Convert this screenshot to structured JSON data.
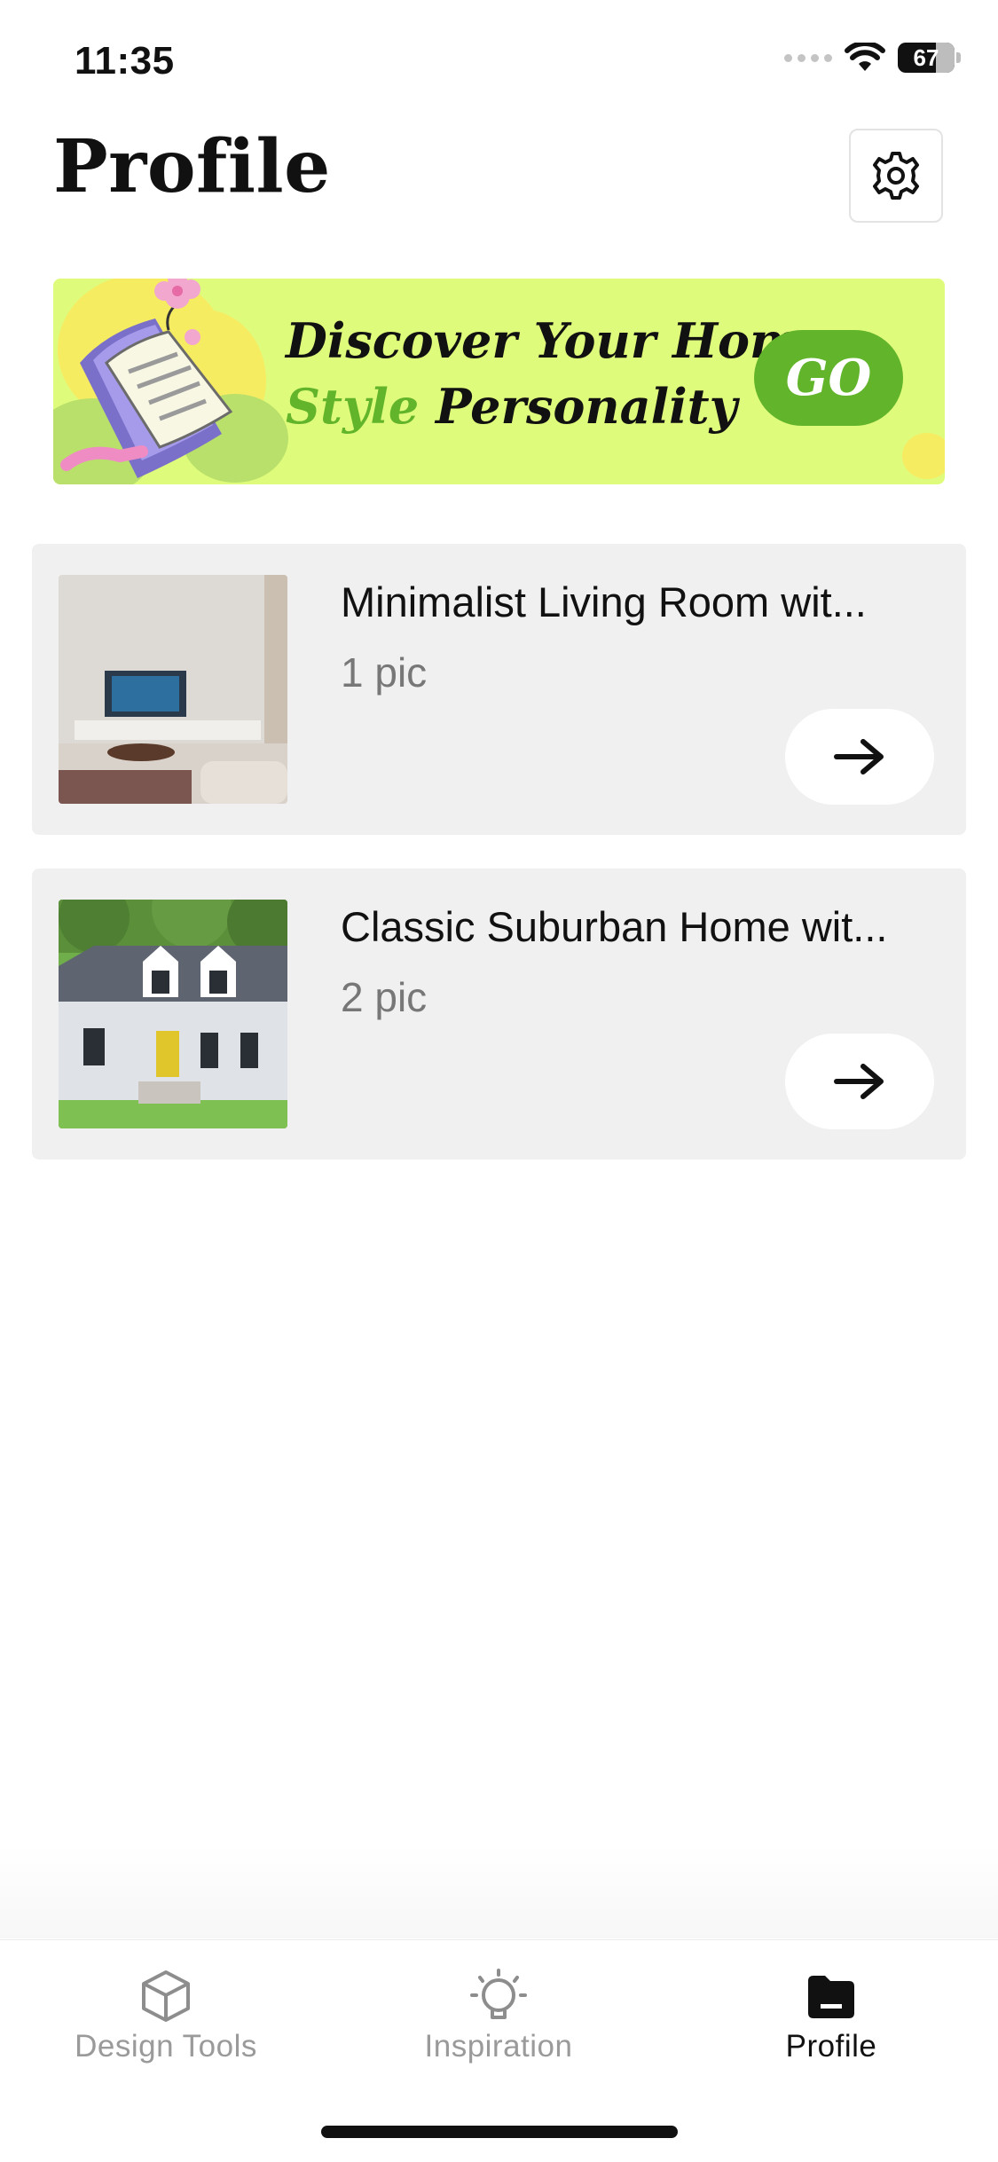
{
  "status_bar": {
    "time": "11:35",
    "battery": "67"
  },
  "header": {
    "title": "Profile",
    "settings_icon": "gear-icon"
  },
  "banner": {
    "line1": "Discover Your Home",
    "line2_green": "Style",
    "line2_rest": " Personality",
    "go_label": "GO",
    "colors": {
      "background": "#dffb7c",
      "accent": "#62b52b"
    }
  },
  "projects": [
    {
      "title": "Minimalist Living Room wit...",
      "count": "1 pic"
    },
    {
      "title": "Classic Suburban Home wit...",
      "count": "2 pic"
    }
  ],
  "tabbar": {
    "tabs": [
      {
        "label": "Design Tools",
        "icon": "cube-icon",
        "active": false
      },
      {
        "label": "Inspiration",
        "icon": "lightbulb-icon",
        "active": false
      },
      {
        "label": "Profile",
        "icon": "folder-icon",
        "active": true
      }
    ]
  }
}
